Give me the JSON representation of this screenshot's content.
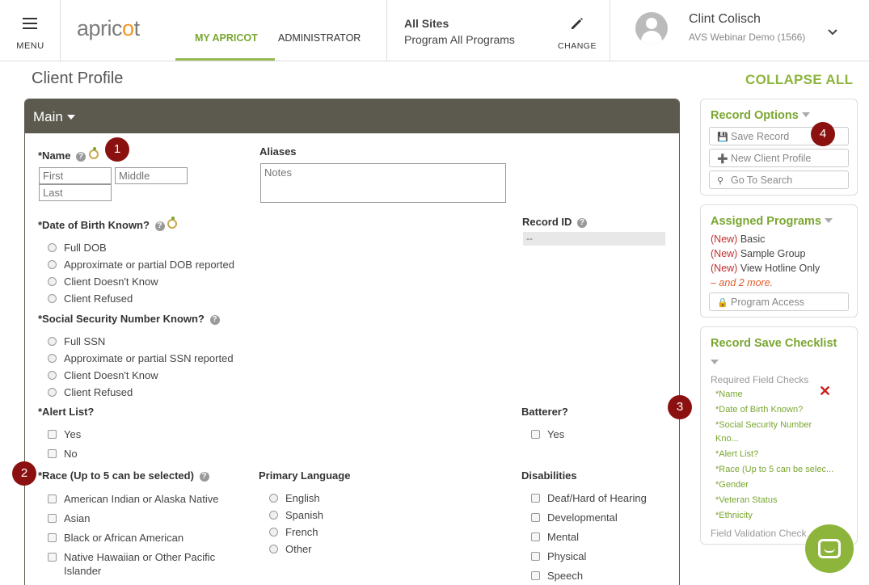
{
  "topbar": {
    "menu_label": "MENU",
    "logo_text_a": "apric",
    "logo_text_b": "o",
    "logo_text_c": "t",
    "tabs": [
      {
        "label": "MY APRICOT",
        "active": true
      },
      {
        "label": "ADMINISTRATOR",
        "active": false
      }
    ],
    "sites_line1": "All Sites",
    "sites_line2": "Program All Programs",
    "change_label": "CHANGE",
    "user_name": "Clint Colisch",
    "user_org": "AVS Webinar Demo (1566)"
  },
  "page": {
    "title": "Client Profile",
    "collapse_all": "COLLAPSE ALL"
  },
  "main_panel": {
    "title": "Main",
    "name_label": "*Name",
    "first_placeholder": "First",
    "middle_placeholder": "Middle",
    "last_placeholder": "Last",
    "aliases_label": "Aliases",
    "aliases_placeholder": "Notes",
    "dob_label": "*Date of Birth Known?",
    "dob_options": [
      "Full DOB",
      "Approximate or partial DOB reported",
      "Client Doesn't Know",
      "Client Refused"
    ],
    "record_id_label": "Record ID",
    "record_id_value": "--",
    "ssn_label": "*Social Security Number Known?",
    "ssn_options": [
      "Full SSN",
      "Approximate or partial SSN reported",
      "Client Doesn't Know",
      "Client Refused"
    ],
    "alert_label": "*Alert List?",
    "alert_options": [
      "Yes",
      "No"
    ],
    "batterer_label": "Batterer?",
    "batterer_options": [
      "Yes"
    ],
    "race_label": "*Race (Up to 5 can be selected)",
    "race_options": [
      "American Indian or Alaska Native",
      "Asian",
      "Black or African American",
      "Native Hawaiian or Other Pacific",
      "Islander"
    ],
    "language_label": "Primary Language",
    "language_options": [
      "English",
      "Spanish",
      "French",
      "Other"
    ],
    "disabilities_label": "Disabilities",
    "disabilities_options": [
      "Deaf/Hard of Hearing",
      "Developmental",
      "Mental",
      "Physical",
      "Speech"
    ]
  },
  "record_options": {
    "title": "Record Options",
    "buttons": [
      "Save Record",
      "New Client Profile",
      "Go To Search"
    ]
  },
  "assigned_programs": {
    "title": "Assigned Programs",
    "new_tag": "(New)",
    "programs": [
      "Basic",
      "Sample Group",
      "View Hotline Only"
    ],
    "more": "– and 2 more.",
    "access_button": "Program Access"
  },
  "checklist": {
    "title": "Record Save Checklist",
    "required_label": "Required Field Checks",
    "items": [
      "*Name",
      "*Date of Birth Known?",
      "*Social Security Number",
      "Kno...",
      "*Alert List?",
      "*Race (Up to 5 can be selec...",
      "*Gender",
      "*Veteran Status",
      "*Ethnicity"
    ],
    "validation_label": "Field Validation Check"
  },
  "badges": [
    "1",
    "2",
    "3",
    "4"
  ],
  "colors": {
    "accent": "#7aa630",
    "header_bar": "#5c5a4f",
    "badge": "#8b1111",
    "new_tag": "#c03030"
  }
}
